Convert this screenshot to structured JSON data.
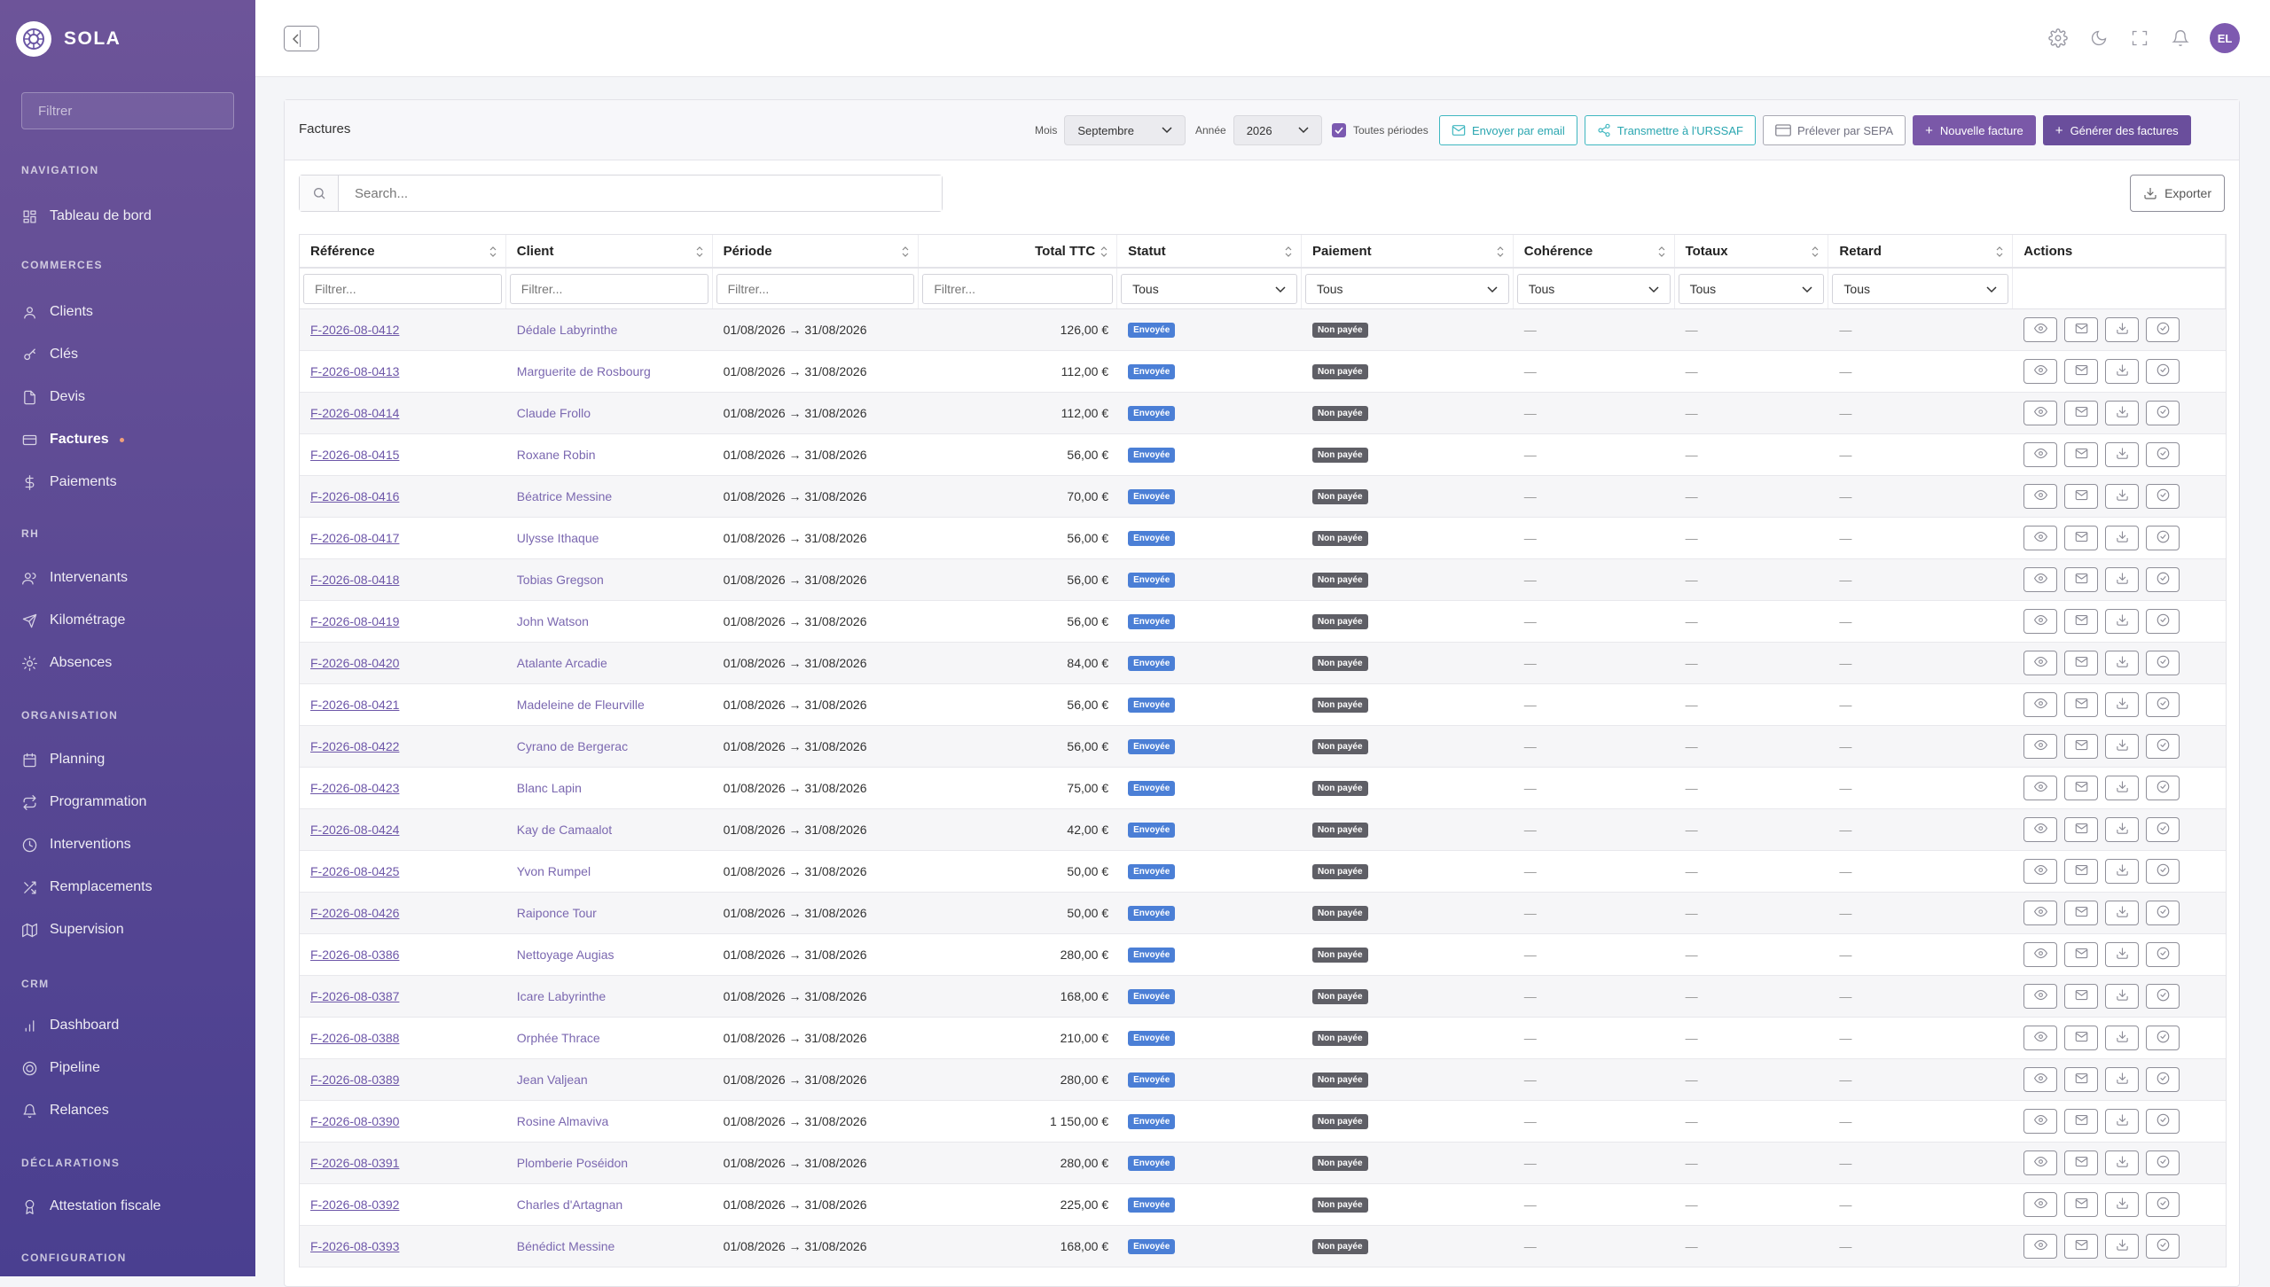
{
  "brand": {
    "name": "SOLA"
  },
  "sidebar": {
    "filter_placeholder": "Filtrer",
    "sections": [
      {
        "title": "NAVIGATION",
        "items": [
          {
            "label": "Tableau de bord",
            "icon": "dashboard-icon"
          }
        ]
      },
      {
        "title": "COMMERCES",
        "items": [
          {
            "label": "Clients",
            "icon": "users-icon"
          },
          {
            "label": "Clés",
            "icon": "key-icon"
          },
          {
            "label": "Devis",
            "icon": "document-icon"
          },
          {
            "label": "Factures",
            "icon": "invoice-icon",
            "active": true
          },
          {
            "label": "Paiements",
            "icon": "dollar-icon"
          }
        ]
      },
      {
        "title": "RH",
        "items": [
          {
            "label": "Intervenants",
            "icon": "team-icon"
          },
          {
            "label": "Kilométrage",
            "icon": "send-icon"
          },
          {
            "label": "Absences",
            "icon": "sun-icon"
          }
        ]
      },
      {
        "title": "ORGANISATION",
        "items": [
          {
            "label": "Planning",
            "icon": "calendar-icon"
          },
          {
            "label": "Programmation",
            "icon": "repeat-icon"
          },
          {
            "label": "Interventions",
            "icon": "clock-icon"
          },
          {
            "label": "Remplacements",
            "icon": "shuffle-icon"
          },
          {
            "label": "Supervision",
            "icon": "map-icon"
          }
        ]
      },
      {
        "title": "CRM",
        "items": [
          {
            "label": "Dashboard",
            "icon": "bar-chart-icon"
          },
          {
            "label": "Pipeline",
            "icon": "target-icon"
          },
          {
            "label": "Relances",
            "icon": "bell-icon"
          }
        ]
      },
      {
        "title": "DÉCLARATIONS",
        "items": [
          {
            "label": "Attestation fiscale",
            "icon": "award-icon"
          }
        ]
      },
      {
        "title": "CONFIGURATION",
        "items": []
      }
    ]
  },
  "topbar": {
    "avatar_initials": "EL",
    "icons": [
      "settings-icon",
      "moon-icon",
      "fullscreen-icon",
      "bell-icon"
    ]
  },
  "page": {
    "title": "Factures",
    "mois_label": "Mois",
    "mois_value": "Septembre",
    "annee_label": "Année",
    "annee_value": "2026",
    "toutes_periodes": "Toutes périodes",
    "btn_email": "Envoyer par email",
    "btn_urssaf": "Transmettre à l'URSSAF",
    "btn_sepa": "Prélever par SEPA",
    "btn_new": "Nouvelle facture",
    "btn_generate": "Générer des factures",
    "search_placeholder": "Search...",
    "export": "Exporter"
  },
  "table": {
    "columns": [
      "Référence",
      "Client",
      "Période",
      "Total TTC",
      "Statut",
      "Paiement",
      "Cohérence",
      "Totaux",
      "Retard",
      "Actions"
    ],
    "filter_placeholder": "Filtrer...",
    "select_default": "Tous",
    "status_label": "Envoyée",
    "payment_label": "Non payée",
    "dash": "—",
    "rows": [
      {
        "ref": "F-2026-08-0412",
        "client": "Dédale Labyrinthe",
        "period": "01/08/2026 → 31/08/2026",
        "total": "126,00 €"
      },
      {
        "ref": "F-2026-08-0413",
        "client": "Marguerite de Rosbourg",
        "period": "01/08/2026 → 31/08/2026",
        "total": "112,00 €"
      },
      {
        "ref": "F-2026-08-0414",
        "client": "Claude Frollo",
        "period": "01/08/2026 → 31/08/2026",
        "total": "112,00 €"
      },
      {
        "ref": "F-2026-08-0415",
        "client": "Roxane Robin",
        "period": "01/08/2026 → 31/08/2026",
        "total": "56,00 €"
      },
      {
        "ref": "F-2026-08-0416",
        "client": "Béatrice Messine",
        "period": "01/08/2026 → 31/08/2026",
        "total": "70,00 €"
      },
      {
        "ref": "F-2026-08-0417",
        "client": "Ulysse Ithaque",
        "period": "01/08/2026 → 31/08/2026",
        "total": "56,00 €"
      },
      {
        "ref": "F-2026-08-0418",
        "client": "Tobias Gregson",
        "period": "01/08/2026 → 31/08/2026",
        "total": "56,00 €"
      },
      {
        "ref": "F-2026-08-0419",
        "client": "John Watson",
        "period": "01/08/2026 → 31/08/2026",
        "total": "56,00 €"
      },
      {
        "ref": "F-2026-08-0420",
        "client": "Atalante Arcadie",
        "period": "01/08/2026 → 31/08/2026",
        "total": "84,00 €"
      },
      {
        "ref": "F-2026-08-0421",
        "client": "Madeleine de Fleurville",
        "period": "01/08/2026 → 31/08/2026",
        "total": "56,00 €"
      },
      {
        "ref": "F-2026-08-0422",
        "client": "Cyrano de Bergerac",
        "period": "01/08/2026 → 31/08/2026",
        "total": "56,00 €"
      },
      {
        "ref": "F-2026-08-0423",
        "client": "Blanc Lapin",
        "period": "01/08/2026 → 31/08/2026",
        "total": "75,00 €"
      },
      {
        "ref": "F-2026-08-0424",
        "client": "Kay de Camaalot",
        "period": "01/08/2026 → 31/08/2026",
        "total": "42,00 €"
      },
      {
        "ref": "F-2026-08-0425",
        "client": "Yvon Rumpel",
        "period": "01/08/2026 → 31/08/2026",
        "total": "50,00 €"
      },
      {
        "ref": "F-2026-08-0426",
        "client": "Raiponce Tour",
        "period": "01/08/2026 → 31/08/2026",
        "total": "50,00 €"
      },
      {
        "ref": "F-2026-08-0386",
        "client": "Nettoyage Augias",
        "period": "01/08/2026 → 31/08/2026",
        "total": "280,00 €"
      },
      {
        "ref": "F-2026-08-0387",
        "client": "Icare Labyrinthe",
        "period": "01/08/2026 → 31/08/2026",
        "total": "168,00 €"
      },
      {
        "ref": "F-2026-08-0388",
        "client": "Orphée Thrace",
        "period": "01/08/2026 → 31/08/2026",
        "total": "210,00 €"
      },
      {
        "ref": "F-2026-08-0389",
        "client": "Jean Valjean",
        "period": "01/08/2026 → 31/08/2026",
        "total": "280,00 €"
      },
      {
        "ref": "F-2026-08-0390",
        "client": "Rosine Almaviva",
        "period": "01/08/2026 → 31/08/2026",
        "total": "1 150,00 €"
      },
      {
        "ref": "F-2026-08-0391",
        "client": "Plomberie Poséidon",
        "period": "01/08/2026 → 31/08/2026",
        "total": "280,00 €"
      },
      {
        "ref": "F-2026-08-0392",
        "client": "Charles d'Artagnan",
        "period": "01/08/2026 → 31/08/2026",
        "total": "225,00 €"
      },
      {
        "ref": "F-2026-08-0393",
        "client": "Bénédict Messine",
        "period": "01/08/2026 → 31/08/2026",
        "total": "168,00 €"
      }
    ]
  }
}
